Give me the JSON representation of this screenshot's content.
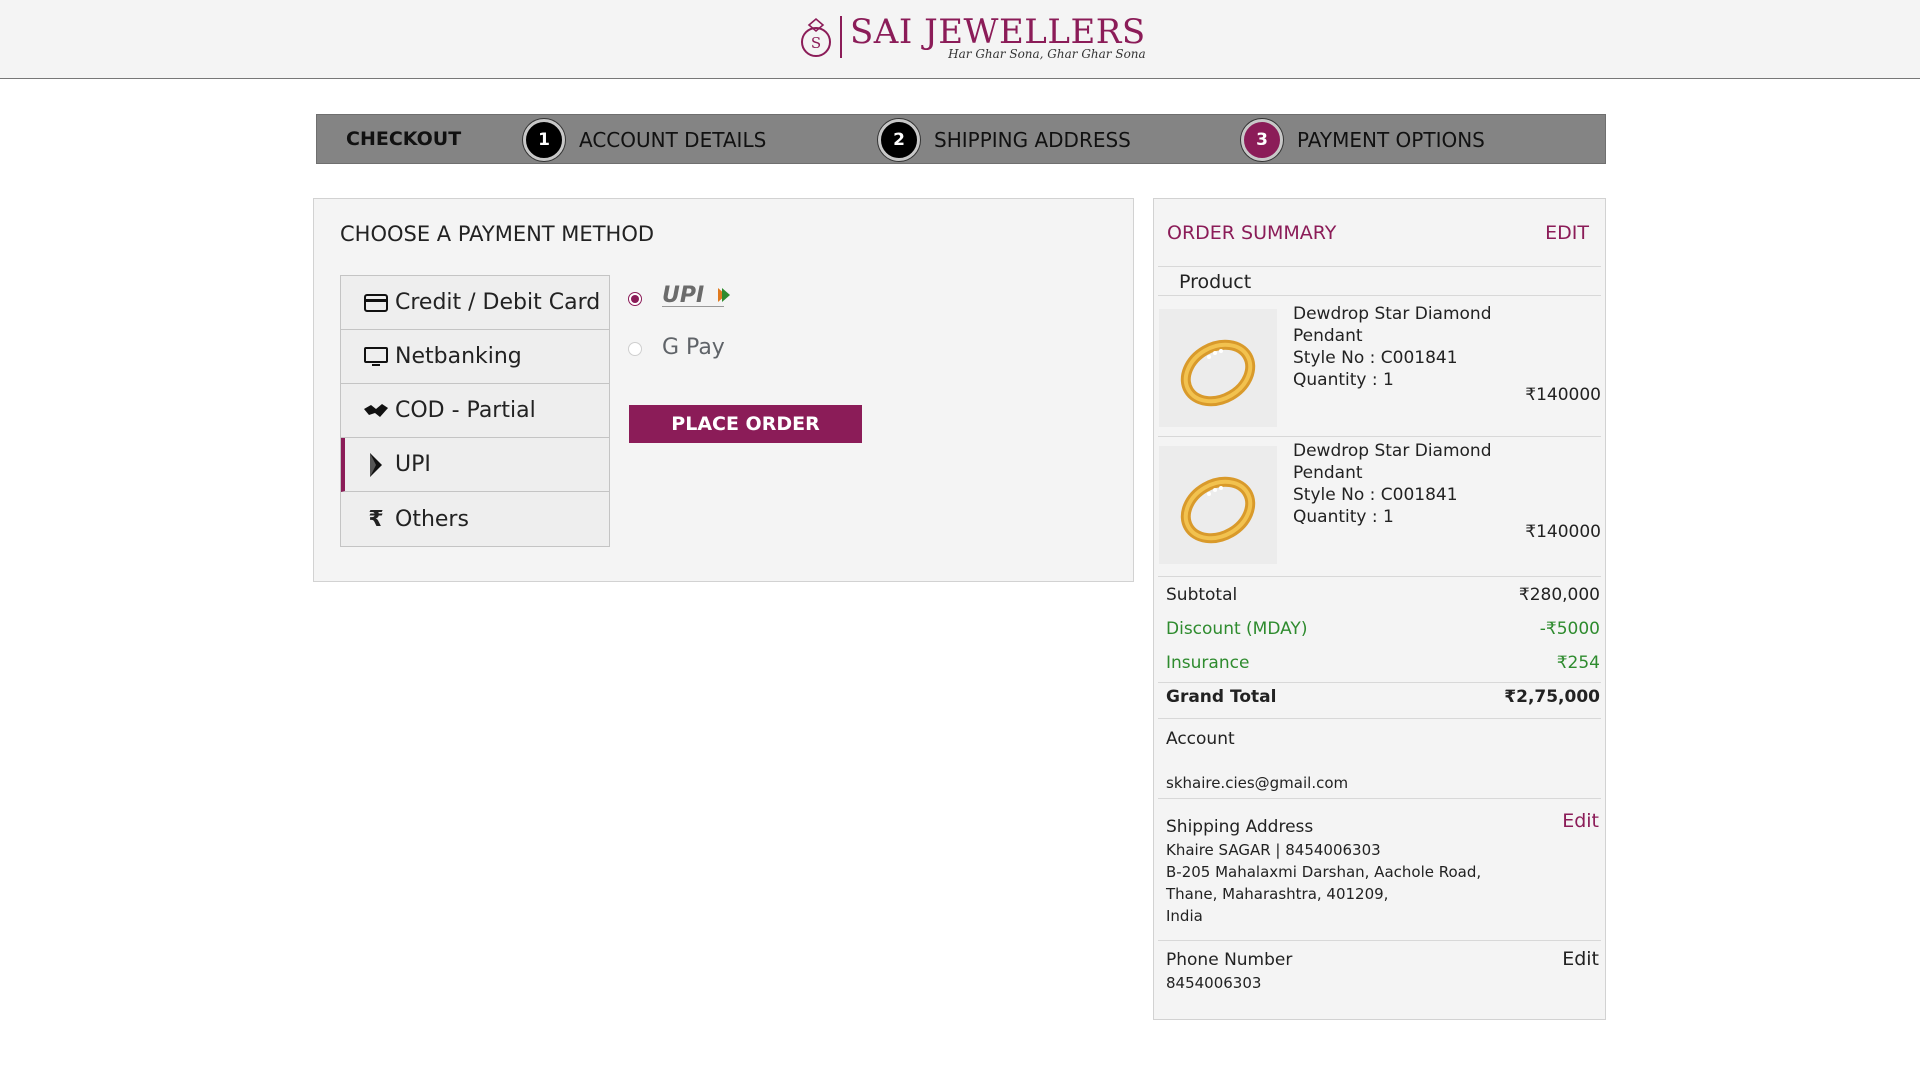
{
  "brand": {
    "name": "SAI JEWELLERS",
    "tagline": "Har Ghar Sona, Ghar Ghar Sona",
    "color": "#8b1c58"
  },
  "stepper": {
    "title": "CHECKOUT",
    "steps": [
      {
        "number": "1",
        "label": "ACCOUNT DETAILS"
      },
      {
        "number": "2",
        "label": "SHIPPING ADDRESS"
      },
      {
        "number": "3",
        "label": "PAYMENT OPTIONS",
        "active": true
      }
    ]
  },
  "payment": {
    "title": "CHOOSE A PAYMENT METHOD",
    "methods": [
      {
        "label": "Credit / Debit Card",
        "icon": "credit-card-icon"
      },
      {
        "label": "Netbanking",
        "icon": "monitor-icon"
      },
      {
        "label": "COD - Partial",
        "icon": "handshake-icon"
      },
      {
        "label": "UPI",
        "icon": "upi-icon",
        "active": true
      },
      {
        "label": "Others",
        "icon": "rupee-icon"
      }
    ],
    "upi_options": [
      {
        "name": "UPI",
        "selected": true
      },
      {
        "name": "G Pay",
        "selected": false
      }
    ],
    "place_order_label": "PLACE ORDER"
  },
  "summary": {
    "title": "ORDER SUMMARY",
    "edit_label": "EDIT",
    "product_header": "Product",
    "products": [
      {
        "name": "Dewdrop Star Diamond Pendant",
        "style": "Style No : C001841",
        "quantity": "Quantity : 1",
        "price": "₹140000"
      },
      {
        "name": "Dewdrop Star Diamond Pendant",
        "style": "Style No : C001841",
        "quantity": "Quantity : 1",
        "price": "₹140000"
      }
    ],
    "subtotal_label": "Subtotal",
    "subtotal_value": "₹280,000",
    "discount_label": "Discount (MDAY)",
    "discount_value": "-₹5000",
    "insurance_label": "Insurance",
    "insurance_value": "₹254",
    "grand_total_label": "Grand Total",
    "grand_total_value": "₹2,75,000",
    "account_label": "Account",
    "account_email": "skhaire.cies@gmail.com",
    "shipping_label": "Shipping Address",
    "shipping_edit": "Edit",
    "shipping_name": "Khaire SAGAR | 8454006303",
    "shipping_line1": "B-205 Mahalaxmi Darshan, Aachole Road,",
    "shipping_line2": "Thane, Maharashtra, 401209,",
    "shipping_line3": "India",
    "phone_label": "Phone Number",
    "phone_edit": "Edit",
    "phone_value": "8454006303"
  }
}
